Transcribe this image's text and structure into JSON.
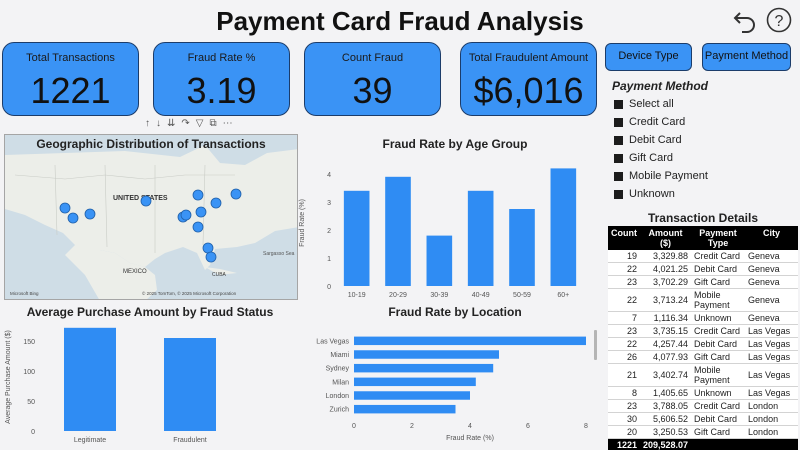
{
  "header": {
    "title": "Payment Card Fraud Analysis",
    "back_icon": "undo-arrow-icon",
    "help_icon": "question-mark-icon"
  },
  "kpis": [
    {
      "label": "Total Transactions",
      "value": "1221"
    },
    {
      "label": "Fraud Rate %",
      "value": "3.19"
    },
    {
      "label": "Count Fraud",
      "value": "39"
    },
    {
      "label": "Total Fraudulent Amount",
      "value": "$6,016"
    }
  ],
  "slicer_buttons": {
    "device_type": "Device Type",
    "payment_method": "Payment Method"
  },
  "payment_method_slicer": {
    "title": "Payment Method",
    "items": [
      "Select all",
      "Credit Card",
      "Debit Card",
      "Gift Card",
      "Mobile Payment",
      "Unknown"
    ]
  },
  "map": {
    "title": "Geographic Distribution of Transactions",
    "labels": {
      "country": "UNITED STATES",
      "mexico": "MEXICO",
      "cuba": "CUBA",
      "sargasso": "Sargasso Sea"
    },
    "attribution": "© 2025 TomTom, © 2025 Microsoft Corporation",
    "logo": "Microsoft Bing",
    "dot_color": "#3a93f5"
  },
  "chart_data": [
    {
      "type": "bar",
      "title": "Fraud Rate by Age Group",
      "categories": [
        "10-19",
        "20-29",
        "30-39",
        "40-49",
        "50-59",
        "60+"
      ],
      "values": [
        3.4,
        3.9,
        1.8,
        3.4,
        2.75,
        4.2
      ],
      "ylabel": "Fraud Rate (%)",
      "ylim": [
        0,
        4.5
      ],
      "yticks": [
        0,
        1,
        2,
        3,
        4
      ],
      "color": "#2f8cf3"
    },
    {
      "type": "bar",
      "title": "Average Purchase Amount by Fraud Status",
      "categories": [
        "Legitimate",
        "Fraudulent"
      ],
      "values": [
        172,
        155
      ],
      "ylabel": "Average Purchase Amount ($)",
      "ylim": [
        0,
        180
      ],
      "yticks": [
        0,
        50,
        100,
        150
      ],
      "color": "#2f8cf3"
    },
    {
      "type": "bar",
      "orientation": "horizontal",
      "title": "Fraud Rate by Location",
      "categories": [
        "Las Vegas",
        "Miami",
        "Sydney",
        "Milan",
        "London",
        "Zurich"
      ],
      "values": [
        8.0,
        5.0,
        4.8,
        4.2,
        4.0,
        3.5
      ],
      "xlabel": "Fraud Rate (%)",
      "xlim": [
        0,
        8
      ],
      "xticks": [
        0,
        2,
        4,
        6,
        8
      ],
      "color": "#2f8cf3"
    }
  ],
  "transactions": {
    "title": "Transaction Details",
    "columns": [
      "Count",
      "Amount ($)",
      "Payment Type",
      "City"
    ],
    "rows": [
      [
        "19",
        "3,329.88",
        "Credit Card",
        "Geneva"
      ],
      [
        "22",
        "4,021.25",
        "Debit Card",
        "Geneva"
      ],
      [
        "23",
        "3,702.29",
        "Gift Card",
        "Geneva"
      ],
      [
        "22",
        "3,713.24",
        "Mobile Payment",
        "Geneva"
      ],
      [
        "7",
        "1,116.34",
        "Unknown",
        "Geneva"
      ],
      [
        "23",
        "3,735.15",
        "Credit Card",
        "Las Vegas"
      ],
      [
        "22",
        "4,257.44",
        "Debit Card",
        "Las Vegas"
      ],
      [
        "26",
        "4,077.93",
        "Gift Card",
        "Las Vegas"
      ],
      [
        "21",
        "3,402.74",
        "Mobile Payment",
        "Las Vegas"
      ],
      [
        "8",
        "1,405.65",
        "Unknown",
        "Las Vegas"
      ],
      [
        "23",
        "3,788.05",
        "Credit Card",
        "London"
      ],
      [
        "30",
        "5,606.52",
        "Debit Card",
        "London"
      ],
      [
        "20",
        "3,250.53",
        "Gift Card",
        "London"
      ]
    ],
    "total": [
      "1221",
      "209,528.07",
      "",
      ""
    ]
  }
}
